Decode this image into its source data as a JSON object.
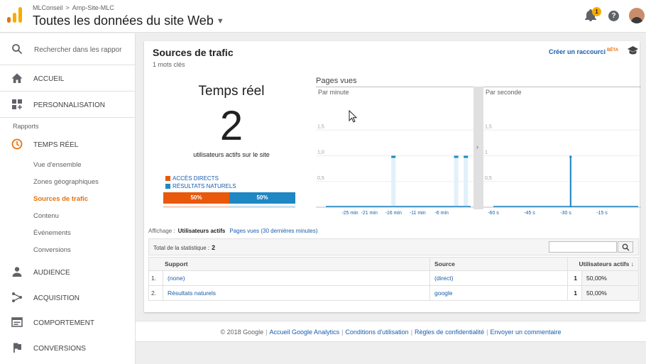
{
  "header": {
    "breadcrumb": [
      "MLConseil",
      "Amp-Site-MLC"
    ],
    "breadcrumb_sep": ">",
    "title": "Toutes les données du site Web",
    "notification_count": "1",
    "help_glyph": "?"
  },
  "sidebar": {
    "search_placeholder": "Rechercher dans les rappor",
    "accueil": "ACCUEIL",
    "personnalisation": "PERSONNALISATION",
    "section_label": "Rapports",
    "temps_reel": "TEMPS RÉEL",
    "sub_items": [
      "Vue d'ensemble",
      "Zones géographiques",
      "Sources de trafic",
      "Contenu",
      "Événements",
      "Conversions"
    ],
    "active_sub": "Sources de trafic",
    "audience": "AUDIENCE",
    "acquisition": "ACQUISITION",
    "comportement": "COMPORTEMENT",
    "conversions": "CONVERSIONS"
  },
  "card": {
    "title": "Sources de trafic",
    "subtitle": "1 mots clés",
    "shortcut": "Créer un raccourci",
    "shortcut_tag": "BÊTA"
  },
  "realtime": {
    "heading": "Temps réel",
    "count": "2",
    "caption": "utilisateurs actifs sur le site",
    "legend": [
      {
        "label": "ACCÈS DIRECTS",
        "color": "#e8590c"
      },
      {
        "label": "RÉSULTATS NATURELS",
        "color": "#1f87c3"
      }
    ],
    "split": [
      {
        "label": "50%",
        "value": 50,
        "color": "#e8590c"
      },
      {
        "label": "50%",
        "value": 50,
        "color": "#1f87c3"
      }
    ]
  },
  "chart_data": [
    {
      "type": "bar",
      "title": "Pages vues",
      "subtitle": "Par minute",
      "y_ticks": [
        "1,5",
        "1,0",
        "0,5"
      ],
      "ylim": [
        0,
        2
      ],
      "x_tick_labels": [
        "-25 min",
        "-21 min",
        "-16 min",
        "-11 min",
        "-6 min"
      ],
      "x_tick_positions": [
        -25,
        -21,
        -16,
        -11,
        -6
      ],
      "xlim": [
        -30,
        0
      ],
      "bars": [
        {
          "x": -16,
          "value": 1
        },
        {
          "x": -3,
          "value": 1
        },
        {
          "x": -1,
          "value": 1
        }
      ]
    },
    {
      "type": "bar",
      "subtitle": "Par seconde",
      "y_ticks": [
        "1,5",
        "1",
        "0,5"
      ],
      "ylim": [
        0,
        2
      ],
      "x_tick_labels": [
        "-60 s",
        "-45 s",
        "-30 s",
        "-15 s"
      ],
      "x_tick_positions": [
        -60,
        -45,
        -30,
        -15
      ],
      "xlim": [
        -60,
        0
      ],
      "bars": [
        {
          "x": -28,
          "value": 1
        }
      ]
    }
  ],
  "table": {
    "display_label": "Affichage :",
    "active_tab": "Utilisateurs actifs",
    "other_tab": "Pages vues (30 dernières minutes)",
    "total_label": "Total de la statistique :",
    "total_value": "2",
    "columns": [
      "Support",
      "Source",
      "Utilisateurs actifs"
    ],
    "rows": [
      {
        "idx": "1.",
        "support": "(none)",
        "source": "(direct)",
        "count": "1",
        "pct": "50,00%"
      },
      {
        "idx": "2.",
        "support": "Résultats naturels",
        "source": "google",
        "count": "1",
        "pct": "50,00%"
      }
    ]
  },
  "footer": {
    "copyright": "© 2018 Google",
    "links": [
      "Accueil Google Analytics",
      "Conditions d'utilisation",
      "Règles de confidentialité",
      "Envoyer un commentaire"
    ]
  }
}
